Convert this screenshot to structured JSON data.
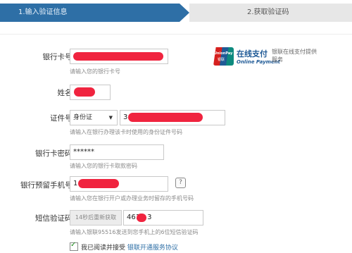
{
  "steps": {
    "step1": "1.输入验证信息",
    "step2": "2.获取验证码"
  },
  "form": {
    "card_number": {
      "label": "银行卡号:",
      "hint": "请输入您的银行卡号"
    },
    "name": {
      "label": "姓名:"
    },
    "id_number": {
      "label": "证件号:",
      "type_value": "身份证",
      "value_prefix": "3",
      "hint": "请输入在银行办理该卡时使用的身份证件号码"
    },
    "card_password": {
      "label": "银行卡密码:",
      "value": "******",
      "hint": "请输入您的银行卡取款密码"
    },
    "phone": {
      "label": "银行预留手机号:",
      "value_prefix": "1",
      "help": "?",
      "hint": "请输入您在银行开户或办理业务时留存的手机号码"
    },
    "sms_code": {
      "label": "短信验证码:",
      "button": "14秒后重新获取",
      "value_prefix": "461",
      "value_suffix": "3",
      "hint": "请输入银联95516发送到您手机上的6位短信验证码"
    },
    "agree": {
      "text": "我已阅读并接受",
      "link": "银联开通服务协议"
    }
  },
  "unionpay": {
    "logo_text": "UnionPay",
    "logo_text_cn": "银联",
    "title": "在线支付",
    "subtitle": "Online Payment",
    "description": "银联在线支付提供服务"
  },
  "colors": {
    "accent": "#2e6fa6",
    "redaction": "#f0243f",
    "brand_blue": "#1f5a96"
  }
}
